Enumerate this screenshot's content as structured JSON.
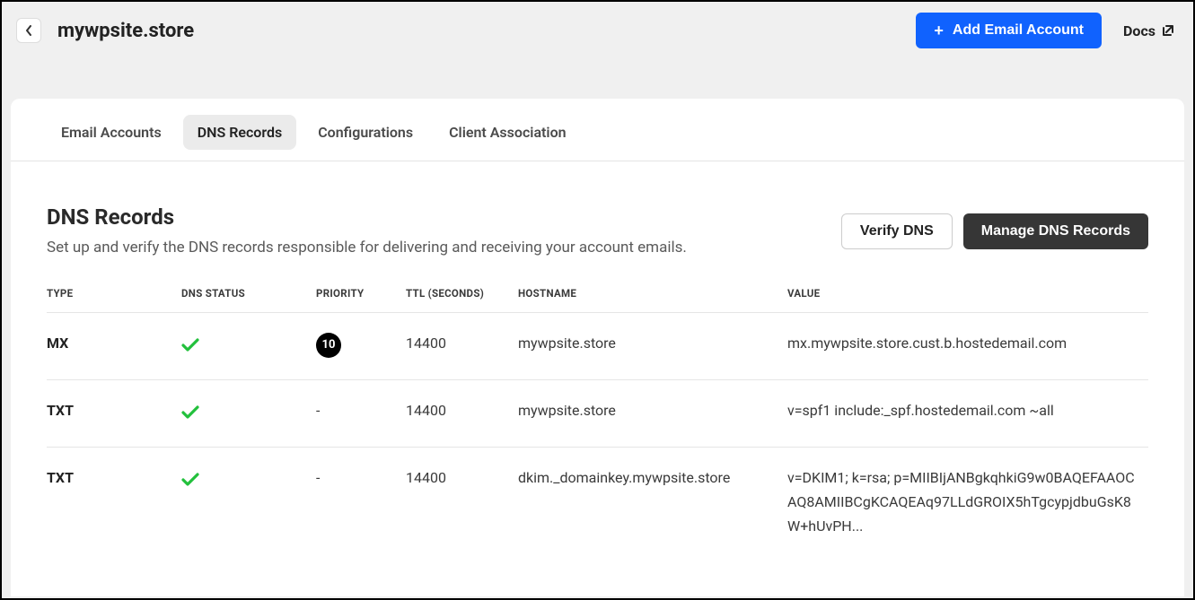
{
  "header": {
    "domain": "mywpsite.store",
    "addEmailLabel": "Add Email Account",
    "docsLabel": "Docs"
  },
  "tabs": [
    {
      "label": "Email Accounts",
      "active": false
    },
    {
      "label": "DNS Records",
      "active": true
    },
    {
      "label": "Configurations",
      "active": false
    },
    {
      "label": "Client Association",
      "active": false
    }
  ],
  "section": {
    "title": "DNS Records",
    "description": "Set up and verify the DNS records responsible for delivering and receiving your account emails.",
    "verifyLabel": "Verify DNS",
    "manageLabel": "Manage DNS Records"
  },
  "table": {
    "headers": {
      "type": "TYPE",
      "status": "DNS STATUS",
      "priority": "PRIORITY",
      "ttl": "TTL (SECONDS)",
      "hostname": "HOSTNAME",
      "value": "VALUE"
    },
    "rows": [
      {
        "type": "MX",
        "status": "ok",
        "priority": "10",
        "priorityBadge": true,
        "ttl": "14400",
        "hostname": "mywpsite.store",
        "value": "mx.mywpsite.store.cust.b.hostedemail.com"
      },
      {
        "type": "TXT",
        "status": "ok",
        "priority": "-",
        "priorityBadge": false,
        "ttl": "14400",
        "hostname": "mywpsite.store",
        "value": "v=spf1 include:_spf.hostedemail.com ~all"
      },
      {
        "type": "TXT",
        "status": "ok",
        "priority": "-",
        "priorityBadge": false,
        "ttl": "14400",
        "hostname": "dkim._domainkey.mywpsite.store",
        "value": "v=DKIM1; k=rsa; p=MIIBIjANBgkqhkiG9w0BAQEFAAOCAQ8AMIIBCgKCAQEAq97LLdGROIX5hTgcypjdbuGsK8W+hUvPH..."
      }
    ]
  }
}
